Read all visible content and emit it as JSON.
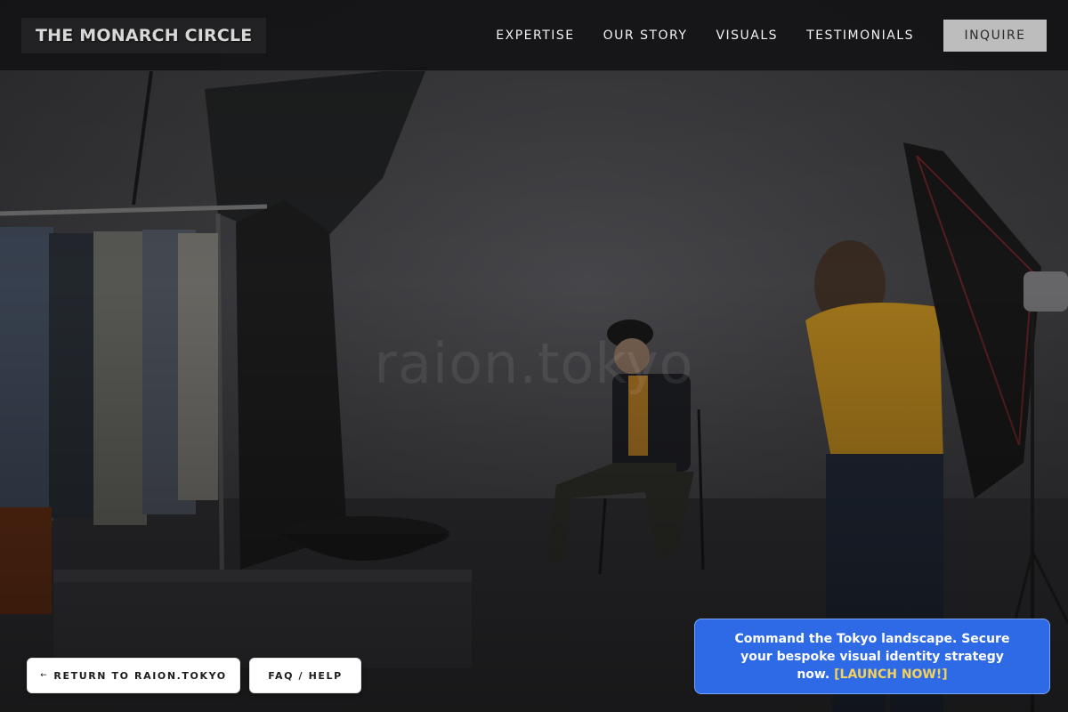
{
  "header": {
    "brand": "THE MONARCH CIRCLE",
    "nav": [
      {
        "label": "EXPERTISE"
      },
      {
        "label": "OUR STORY"
      },
      {
        "label": "VISUALS"
      },
      {
        "label": "TESTIMONIALS"
      }
    ],
    "inquire_label": "INQUIRE"
  },
  "hero": {
    "watermark": "raion.tokyo"
  },
  "footer_buttons": {
    "return_arrow": "←",
    "return_label": "RETURN TO RAION.TOKYO",
    "faq_label": "FAQ / HELP"
  },
  "cta": {
    "text": "Command the Tokyo landscape. Secure your bespoke visual identity strategy now.",
    "link_text": "[LAUNCH NOW!]"
  },
  "colors": {
    "cta_background": "#2e6ae6",
    "cta_link": "#f2d25a",
    "inquire_background": "#bdbdbd",
    "header_background": "#121214"
  }
}
